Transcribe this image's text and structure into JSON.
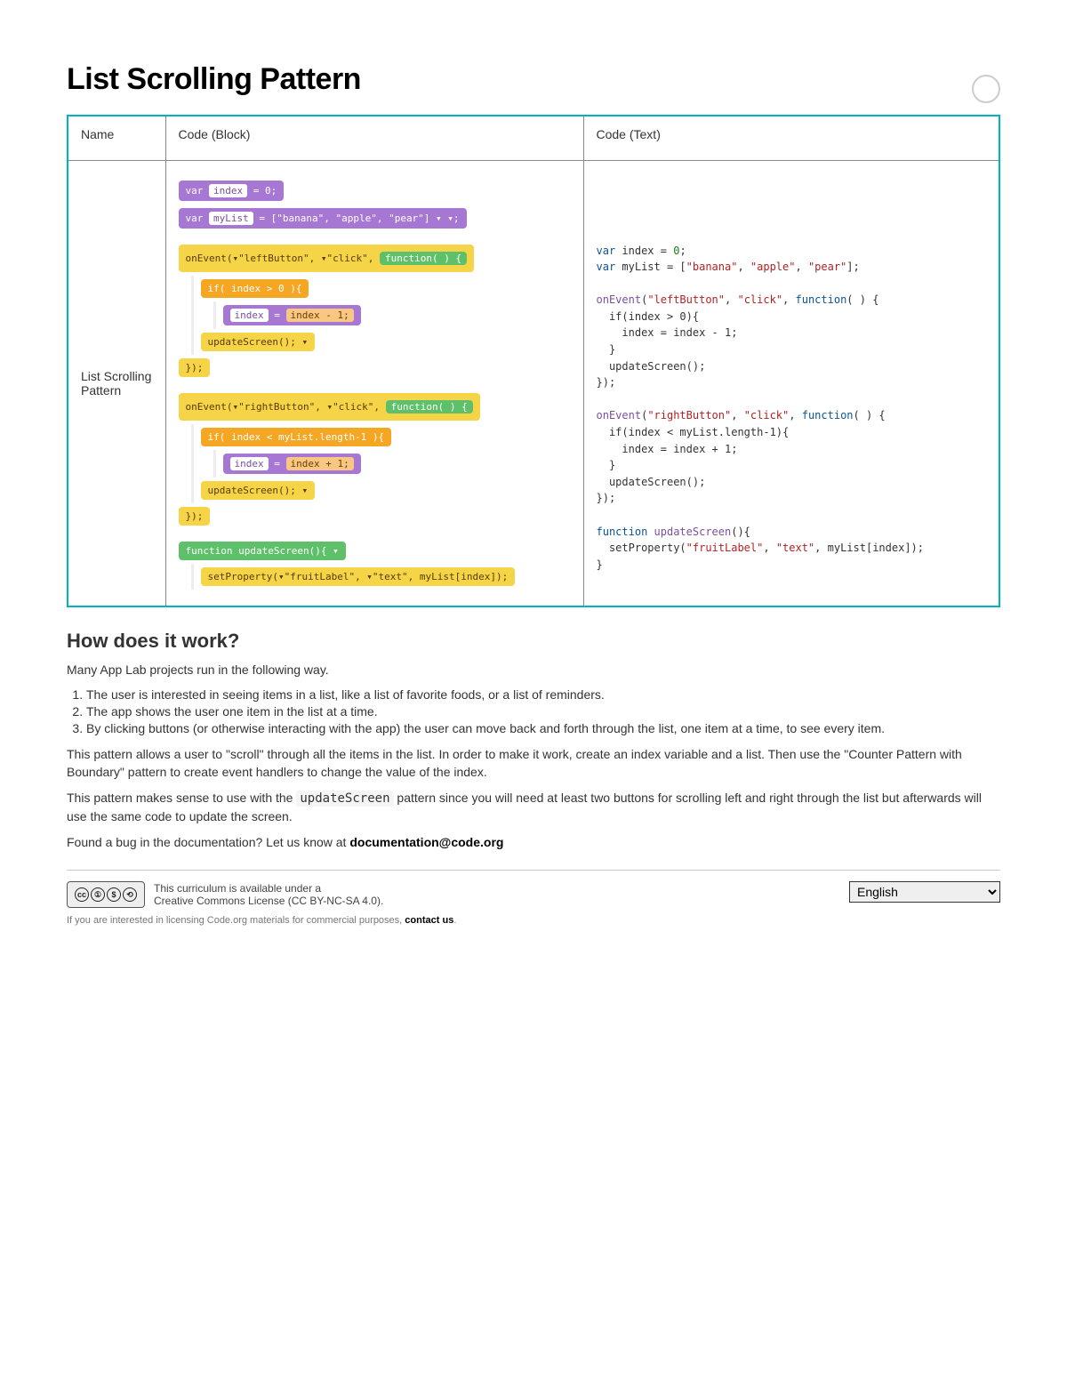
{
  "title": "List Scrolling Pattern",
  "table": {
    "headers": {
      "name": "Name",
      "block": "Code (Block)",
      "text": "Code (Text)"
    },
    "rowName": "List Scrolling Pattern"
  },
  "blocks": {
    "var_index": "var",
    "index_slot": "index",
    "equals_zero": "= 0;",
    "var_mylist": "var",
    "mylist_slot": "myList",
    "list_vals": "= [\"banana\", \"apple\", \"pear\"] ▾ ▾;",
    "onEvt1": "onEvent(▾\"leftButton\", ▾\"click\",",
    "fn_lbl": "function( ) {",
    "if_gt0": "if( index > 0 ){",
    "assign_dec": "index = ",
    "dec_expr": "index - 1;",
    "update_call": "updateScreen(); ▾",
    "close": "});",
    "onEvt2": "onEvent(▾\"rightButton\", ▾\"click\",",
    "fn_lbl2": "function( ) {",
    "if_lt": "if( index < myList.length-1 ){",
    "inc_expr": "index + 1;",
    "fn_def": "function updateScreen(){ ▾",
    "setprop": "setProperty(▾\"fruitLabel\", ▾\"text\", myList[index]);"
  },
  "code_text": {
    "l1a": "var ",
    "l1b": "index = ",
    "l1c": "0",
    "l1d": ";",
    "l2a": "var ",
    "l2b": "myList = [",
    "l2c": "\"banana\"",
    "l2d": ", ",
    "l2e": "\"apple\"",
    "l2f": ", ",
    "l2g": "\"pear\"",
    "l2h": "];",
    "l3a": "onEvent",
    "l3b": "(",
    "l3c": "\"leftButton\"",
    "l3d": ", ",
    "l3e": "\"click\"",
    "l3f": ", ",
    "l3g": "function",
    "l3h": "( ) {",
    "l4": "  if(index > 0){",
    "l5": "    index = index - 1;",
    "l6": "  }",
    "l7": "  updateScreen();",
    "l8": "});",
    "l9a": "onEvent",
    "l9b": "(",
    "l9c": "\"rightButton\"",
    "l9d": ", ",
    "l9e": "\"click\"",
    "l9f": ", ",
    "l9g": "function",
    "l9h": "( ) {",
    "l10": "  if(index < myList.length-1){",
    "l11": "    index = index + 1;",
    "l12": "  }",
    "l13": "  updateScreen();",
    "l14": "});",
    "l15a": "function ",
    "l15b": "updateScreen",
    "l15c": "(){",
    "l16a": "  setProperty(",
    "l16b": "\"fruitLabel\"",
    "l16c": ", ",
    "l16d": "\"text\"",
    "l16e": ", myList[index]);",
    "l17": "}"
  },
  "how": {
    "heading": "How does it work?",
    "intro": "Many App Lab projects run in the following way.",
    "steps": [
      "The user is interested in seeing items in a list, like a list of favorite foods, or a list of reminders.",
      "The app shows the user one item in the list at a time.",
      "By clicking buttons (or otherwise interacting with the app) the user can move back and forth through the list, one item at a time, to see every item."
    ],
    "p1": "This pattern allows a user to \"scroll\" through all the items in the list. In order to make it work, create an index variable and a list. Then use the \"Counter Pattern with Boundary\" pattern to create event handlers to change the value of the index.",
    "p2a": "This pattern makes sense to use with the ",
    "p2code": "updateScreen",
    "p2b": " pattern since you will need at least two buttons for scrolling left and right through the list but afterwards will use the same code to update the screen.",
    "bug_prefix": "Found a bug in the documentation? Let us know at ",
    "bug_email": "documentation@code.org"
  },
  "footer": {
    "cc_line1": "This curriculum is available under a",
    "cc_line2": "Creative Commons License (CC BY-NC-SA 4.0).",
    "lang_selected": "English",
    "licensing_prefix": "If you are interested in licensing Code.org materials for commercial purposes, ",
    "licensing_link": "contact us",
    "licensing_suffix": "."
  }
}
